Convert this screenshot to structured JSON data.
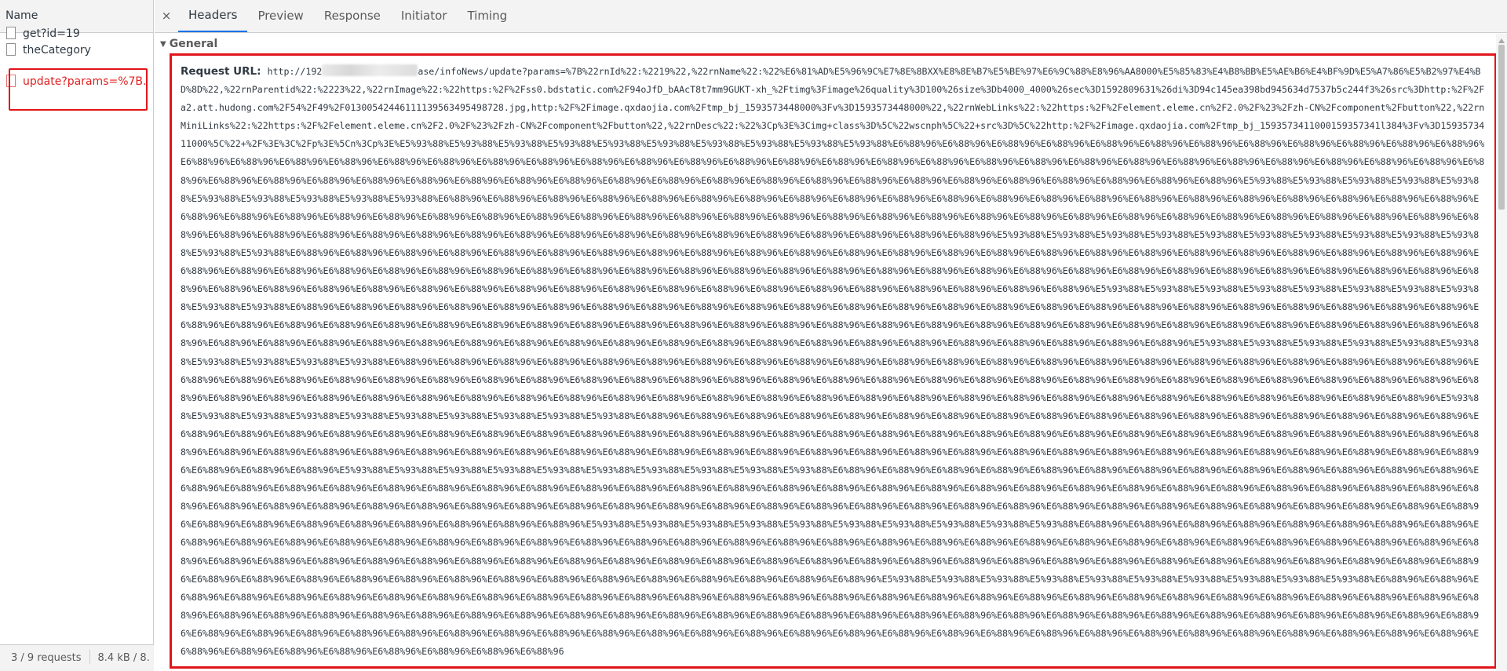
{
  "left_panel": {
    "header": "Name",
    "requests": [
      {
        "name": "get?id=19",
        "status": "ok"
      },
      {
        "name": "theCategory",
        "status": "ok"
      },
      {
        "name": "update?params=%7B…",
        "status": "error"
      }
    ],
    "footer": {
      "requests_count": "3 / 9 requests",
      "transferred": "8.4 kB / 8."
    }
  },
  "details": {
    "close_label": "×",
    "tabs": [
      "Headers",
      "Preview",
      "Response",
      "Initiator",
      "Timing"
    ],
    "active_tab": "Headers",
    "section_title": "General",
    "request_url_label": "Request URL:",
    "url_prefix": "http://192",
    "url_body": "ase/infoNews/update?params=%7B%22rnId%22:%2219%22,%22rnName%22:%22%E6%81%AD%E5%96%9C%E7%8E%8BXX%E8%8E%B7%E5%BE%97%E6%9C%88%E8%96%AA8000%E5%85%83%E4%B8%BB%E5%AE%B6%E4%BF%9D%E5%A7%86%E5%B2%97%E4%BD%8D%22,%22rnParentid%22:%2223%22,%22rnImage%22:%22https:%2F%2Fss0.bdstatic.com%2F94oJfD_bAAcT8t7mm9GUKT-xh_%2Ftimg%3Fimage%26quality%3D100%26size%3Db4000_4000%26sec%3D1592809631%26di%3D94c145ea398bd945634d7537b5c244f3%26src%3Dhttp:%2F%2Fa2.att.hudong.com%2F54%2F49%2F01300542446111139563495498728.jpg,http:%2F%2Fimage.qxdaojia.com%2Ftmp_bj_1593573448000%3Fv%3D1593573448000%22,%22rnWebLinks%22:%22https:%2F%2Felement.eleme.cn%2F2.0%2F%23%2Fzh-CN%2Fcomponent%2Fbutton%22,%22rnMiniLinks%22:%22https:%2F%2Felement.eleme.cn%2F2.0%2F%23%2Fzh-CN%2Fcomponent%2Fbutton%22,%22rnDesc%22:%22%3Cp%3E%3Cimg+class%3D%5C%22wscnph%5C%22+src%3D%5C%22http:%2F%2Fimage.qxdaojia.com%2Ftmp_bj_1593573411000159357341l384%3Fv%3D1593573411000%5C%22+%2F%3E%3C%2Fp%3E%5Cn%3Cp%3E%E5%93%88%E5%93%88%E5%93%88%E5%93%88%E5%93%88%E5%93%88%E5%93%88%E5%93%88%E5%93%88%E5%93%88%E6%88%96%E6%88%96%E6%88%96%E6%88%96%E6%88%96%E6%88%96%E6%88%96%E6%88%96%E6%88%96%E6%88%96%E6%88%96%E6%88%96%E6%88%96%E6%88%96%E6%88%96%E6%88%96%E6%88%96%E6%88%96%E6%88%96%E6%88%96%E6%88%96%E6%88%96%E6%88%96%E6%88%96%E6%88%96%E6%88%96%E6%88%96%E6%88%96%E6%88%96%E6%88%96%E6%88%96%E6%88%96%E6%88%96%E6%88%96%E6%88%96%E6%88%96%E6%88%96%E6%88%96%E6%88%96%E6%88%96%E6%88%96%E6%88%96%E6%88%96%E6%88%96%E6%88%96%E6%88%96%E6%88%96%E6%88%96%E6%88%96%E6%88%96%E6%88%96%E6%88%96%E6%88%96%E6%88%96%E6%88%96%E6%88%96%E6%88%96%E6%88%96%E6%88%96%E6%88%96%E5%93%88%E5%93%88%E5%93%88%E5%93%88%E5%93%88%E5%93%88%E5%93%88%E5%93%88%E5%93%88%E5%93%88%E6%88%96%E6%88%96%E6%88%96%E6%88%96%E6%88%96%E6%88%96%E6%88%96%E6%88%96%E6%88%96%E6%88%96%E6%88%96%E6%88%96%E6%88%96%E6%88%96%E6%88%96%E6%88%96%E6%88%96%E6%88%96%E6%88%96%E6%88%96%E6%88%96%E6%88%96%E6%88%96%E6%88%96%E6%88%96%E6%88%96%E6%88%96%E6%88%96%E6%88%96%E6%88%96%E6%88%96%E6%88%96%E6%88%96%E6%88%96%E6%88%96%E6%88%96%E6%88%96%E6%88%96%E6%88%96%E6%88%96%E6%88%96%E6%88%96%E6%88%96%E6%88%96%E6%88%96%E6%88%96%E6%88%96%E6%88%96%E6%88%96%E6%88%96%E6%88%96%E6%88%96%E6%88%96%E6%88%96%E6%88%96%E6%88%96%E6%88%96%E6%88%96%E6%88%96%E6%88%96%E6%88%96%E6%88%96%E6%88%96%E6%88%96%E5%93%88%E5%93%88%E5%93%88%E5%93%88%E5%93%88%E5%93%88%E5%93%88%E5%93%88%E5%93%88%E5%93%88%E5%93%88%E5%93%88%E6%88%96%E6%88%96%E6%88%96%E6%88%96%E6%88%96%E6%88%96%E6%88%96%E6%88%96%E6%88%96%E6%88%96%E6%88%96%E6%88%96%E6%88%96%E6%88%96%E6%88%96%E6%88%96%E6%88%96%E6%88%96%E6%88%96%E6%88%96%E6%88%96%E6%88%96%E6%88%96%E6%88%96%E6%88%96%E6%88%96%E6%88%96%E6%88%96%E6%88%96%E6%88%96%E6%88%96%E6%88%96%E6%88%96%E6%88%96%E6%88%96%E6%88%96%E6%88%96%E6%88%96%E6%88%96%E6%88%96%E6%88%96%E6%88%96%E6%88%96%E6%88%96%E6%88%96%E6%88%96%E6%88%96%E6%88%96%E6%88%96%E6%88%96%E6%88%96%E6%88%96%E6%88%96%E6%88%96%E6%88%96%E6%88%96%E6%88%96%E6%88%96%E6%88%96%E6%88%96%E6%88%96%E6%88%96%E6%88%96%E6%88%96%E6%88%96%E6%88%96%E6%88%96%E6%88%96%E6%88%96%E5%93%88%E5%93%88%E5%93%88%E5%93%88%E5%93%88%E5%93%88%E5%93%88%E5%93%88%E5%93%88%E5%93%88%E6%88%96%E6%88%96%E6%88%96%E6%88%96%E6%88%96%E6%88%96%E6%88%96%E6%88%96%E6%88%96%E6%88%96%E6%88%96%E6%88%96%E6%88%96%E6%88%96%E6%88%96%E6%88%96%E6%88%96%E6%88%96%E6%88%96%E6%88%96%E6%88%96%E6%88%96%E6%88%96%E6%88%96%E6%88%96%E6%88%96%E6%88%96%E6%88%96%E6%88%96%E6%88%96%E6%88%96%E6%88%96%E6%88%96%E6%88%96%E6%88%96%E6%88%96%E6%88%96%E6%88%96%E6%88%96%E6%88%96%E6%88%96%E6%88%96%E6%88%96%E6%88%96%E6%88%96%E6%88%96%E6%88%96%E6%88%96%E6%88%96%E6%88%96%E6%88%96%E6%88%96%E6%88%96%E6%88%96%E6%88%96%E6%88%96%E6%88%96%E6%88%96%E6%88%96%E6%88%96%E6%88%96%E6%88%96%E6%88%96%E6%88%96%E6%88%96%E6%88%96%E6%88%96%E6%88%96%E6%88%96%E6%88%96%E6%88%96%E5%93%88%E5%93%88%E5%93%88%E5%93%88%E5%93%88%E5%93%88%E5%93%88%E5%93%88%E5%93%88%E5%93%88%E6%88%96%E6%88%96%E6%88%96%E6%88%96%E6%88%96%E6%88%96%E6%88%96%E6%88%96%E6%88%96%E6%88%96%E6%88%96%E6%88%96%E6%88%96%E6%88%96%E6%88%96%E6%88%96%E6%88%96%E6%88%96%E6%88%96%E6%88%96%E6%88%96%E6%88%96%E6%88%96%E6%88%96%E6%88%96%E6%88%96%E6%88%96%E6%88%96%E6%88%96%E6%88%96%E6%88%96%E6%88%96%E6%88%96%E6%88%96%E6%88%96%E6%88%96%E6%88%96%E6%88%96%E6%88%96%E6%88%96%E6%88%96%E6%88%96%E6%88%96%E6%88%96%E6%88%96%E6%88%96%E6%88%96%E6%88%96%E6%88%96%E6%88%96%E6%88%96%E6%88%96%E6%88%96%E6%88%96%E6%88%96%E6%88%96%E6%88%96%E6%88%96%E6%88%96%E6%88%96%E6%88%96%E6%88%96%E6%88%96%E6%88%96%E6%88%96%E6%88%96%E6%88%96%E6%88%96%E6%88%96%E6%88%96%E6%88%96%E6%88%96%E6%88%96%E6%88%96%E5%93%88%E5%93%88%E5%93%88%E5%93%88%E5%93%88%E5%93%88%E5%93%88%E5%93%88%E5%93%88%E5%93%88%E6%88%96%E6%88%96%E6%88%96%E6%88%96%E6%88%96%E6%88%96%E6%88%96%E6%88%96%E6%88%96%E6%88%96%E6%88%96%E6%88%96%E6%88%96%E6%88%96%E6%88%96%E6%88%96%E6%88%96%E6%88%96%E6%88%96%E6%88%96%E6%88%96%E6%88%96%E6%88%96%E6%88%96%E6%88%96%E6%88%96%E6%88%96%E6%88%96%E6%88%96%E6%88%96%E6%88%96%E6%88%96%E6%88%96%E6%88%96%E6%88%96%E6%88%96%E6%88%96%E6%88%96%E6%88%96%E6%88%96%E6%88%96%E6%88%96%E6%88%96%E6%88%96%E6%88%96%E6%88%96%E6%88%96%E6%88%96%E6%88%96%E6%88%96%E6%88%96%E6%88%96%E6%88%96%E6%88%96%E6%88%96%E6%88%96%E6%88%96%E6%88%96%E6%88%96%E6%88%96%E6%88%96%E6%88%96%E6%88%96%E6%88%96%E6%88%96%E6%88%96%E6%88%96%E6%88%96%E6%88%96%E6%88%96%E6%88%96%E6%88%96%E6%88%96%E5%93%88%E5%93%88%E5%93%88%E5%93%88%E5%93%88%E5%93%88%E5%93%88%E5%93%88%E5%93%88%E5%93%88%E6%88%96%E6%88%96%E6%88%96%E6%88%96%E6%88%96%E6%88%96%E6%88%96%E6%88%96%E6%88%96%E6%88%96%E6%88%96%E6%88%96%E6%88%96%E6%88%96%E6%88%96%E6%88%96%E6%88%96%E6%88%96%E6%88%96%E6%88%96%E6%88%96%E6%88%96%E6%88%96%E6%88%96%E6%88%96%E6%88%96%E6%88%96%E6%88%96%E6%88%96%E6%88%96%E6%88%96%E6%88%96%E6%88%96%E6%88%96%E6%88%96%E6%88%96%E6%88%96%E6%88%96%E6%88%96%E6%88%96%E6%88%96%E6%88%96%E6%88%96%E6%88%96%E6%88%96%E6%88%96%E6%88%96%E6%88%96%E6%88%96%E6%88%96%E6%88%96%E6%88%96%E6%88%96%E6%88%96%E6%88%96%E6%88%96%E6%88%96%E6%88%96%E6%88%96%E6%88%96%E6%88%96%E6%88%96%E6%88%96%E6%88%96%E6%88%96%E6%88%96%E6%88%96%E6%88%96%E6%88%96%E6%88%96%E6%88%96%E6%88%96%E6%88%96%E6%88%96%E5%93%88%E5%93%88%E5%93%88%E5%93%88%E5%93%88%E5%93%88%E5%93%88%E5%93%88%E5%93%88%E5%93%88%E6%88%96%E6%88%96%E6%88%96%E6%88%96%E6%88%96%E6%88%96%E6%88%96%E6%88%96%E6%88%96%E6%88%96%E6%88%96%E6%88%96%E6%88%96%E6%88%96%E6%88%96%E6%88%96%E6%88%96%E6%88%96%E6%88%96%E6%88%96%E6%88%96%E6%88%96%E6%88%96%E6%88%96%E6%88%96%E6%88%96%E6%88%96%E6%88%96%E6%88%96%E6%88%96%E6%88%96%E6%88%96%E6%88%96%E6%88%96%E6%88%96%E6%88%96%E6%88%96%E6%88%96%E6%88%96%E6%88%96%E6%88%96%E6%88%96%E6%88%96%E6%88%96%E6%88%96%E6%88%96%E6%88%96%E6%88%96%E6%88%96%E6%88%96%E6%88%96%E6%88%96%E6%88%96%E6%88%96%E6%88%96%E6%88%96%E6%88%96%E6%88%96%E6%88%96%E6%88%96%E6%88%96%E6%88%96%E6%88%96%E6%88%96%E6%88%96%E6%88%96%E6%88%96%E6%88%96%E6%88%96%E6%88%96%E6%88%96%E6%88%96%E6%88%96%E6%88%96%E6%88%96%E5%93%88%E5%93%88%E5%93%88%E5%93%88%E5%93%88%E5%93%88%E5%93%88%E5%93%88%E5%93%88%E5%93%88%E6%88%96%E6%88%96%E6%88%96%E6%88%96%E6%88%96%E6%88%96%E6%88%96%E6%88%96%E6%88%96%E6%88%96%E6%88%96%E6%88%96%E6%88%96%E6%88%96%E6%88%96%E6%88%96%E6%88%96%E6%88%96%E6%88%96%E6%88%96%E6%88%96%E6%88%96%E6%88%96%E6%88%96%E6%88%96%E6%88%96%E6%88%96%E6%88%96%E6%88%96%E6%88%96%E6%88%96%E6%88%96%E6%88%96%E6%88%96%E6%88%96%E6%88%96%E6%88%96%E6%88%96%E6%88%96%E6%88%96%E6%88%96%E6%88%96%E6%88%96%E6%88%96%E6%88%96%E6%88%96%E6%88%96%E6%88%96%E6%88%96%E6%88%96%E6%88%96%E6%88%96%E6%88%96%E6%88%96%E6%88%96%E6%88%96%E6%88%96%E6%88%96%E6%88%96%E6%88%96%E6%88%96%E6%88%96%E6%88%96%E6%88%96%E6%88%96%E6%88%96%E6%88%96%E6%88%96%E6%88%96%E6%88%96%E6%88%96%E6%88%96%E6%88%96%E6%88%96%E6%88%96%E6%88%96%E6%88%96%E6%88%96%E6%88%96%E6%88%96%E6%88%96%E6%88%96%E6%88%96%E6%88%96%E6%88%96%E6%88%96%E6%88%96%E6%88%96%E6%88%96"
  },
  "colors": {
    "error_text": "#e02020",
    "highlight_border": "#e0151b",
    "active_tab_underline": "#1a73e8"
  }
}
